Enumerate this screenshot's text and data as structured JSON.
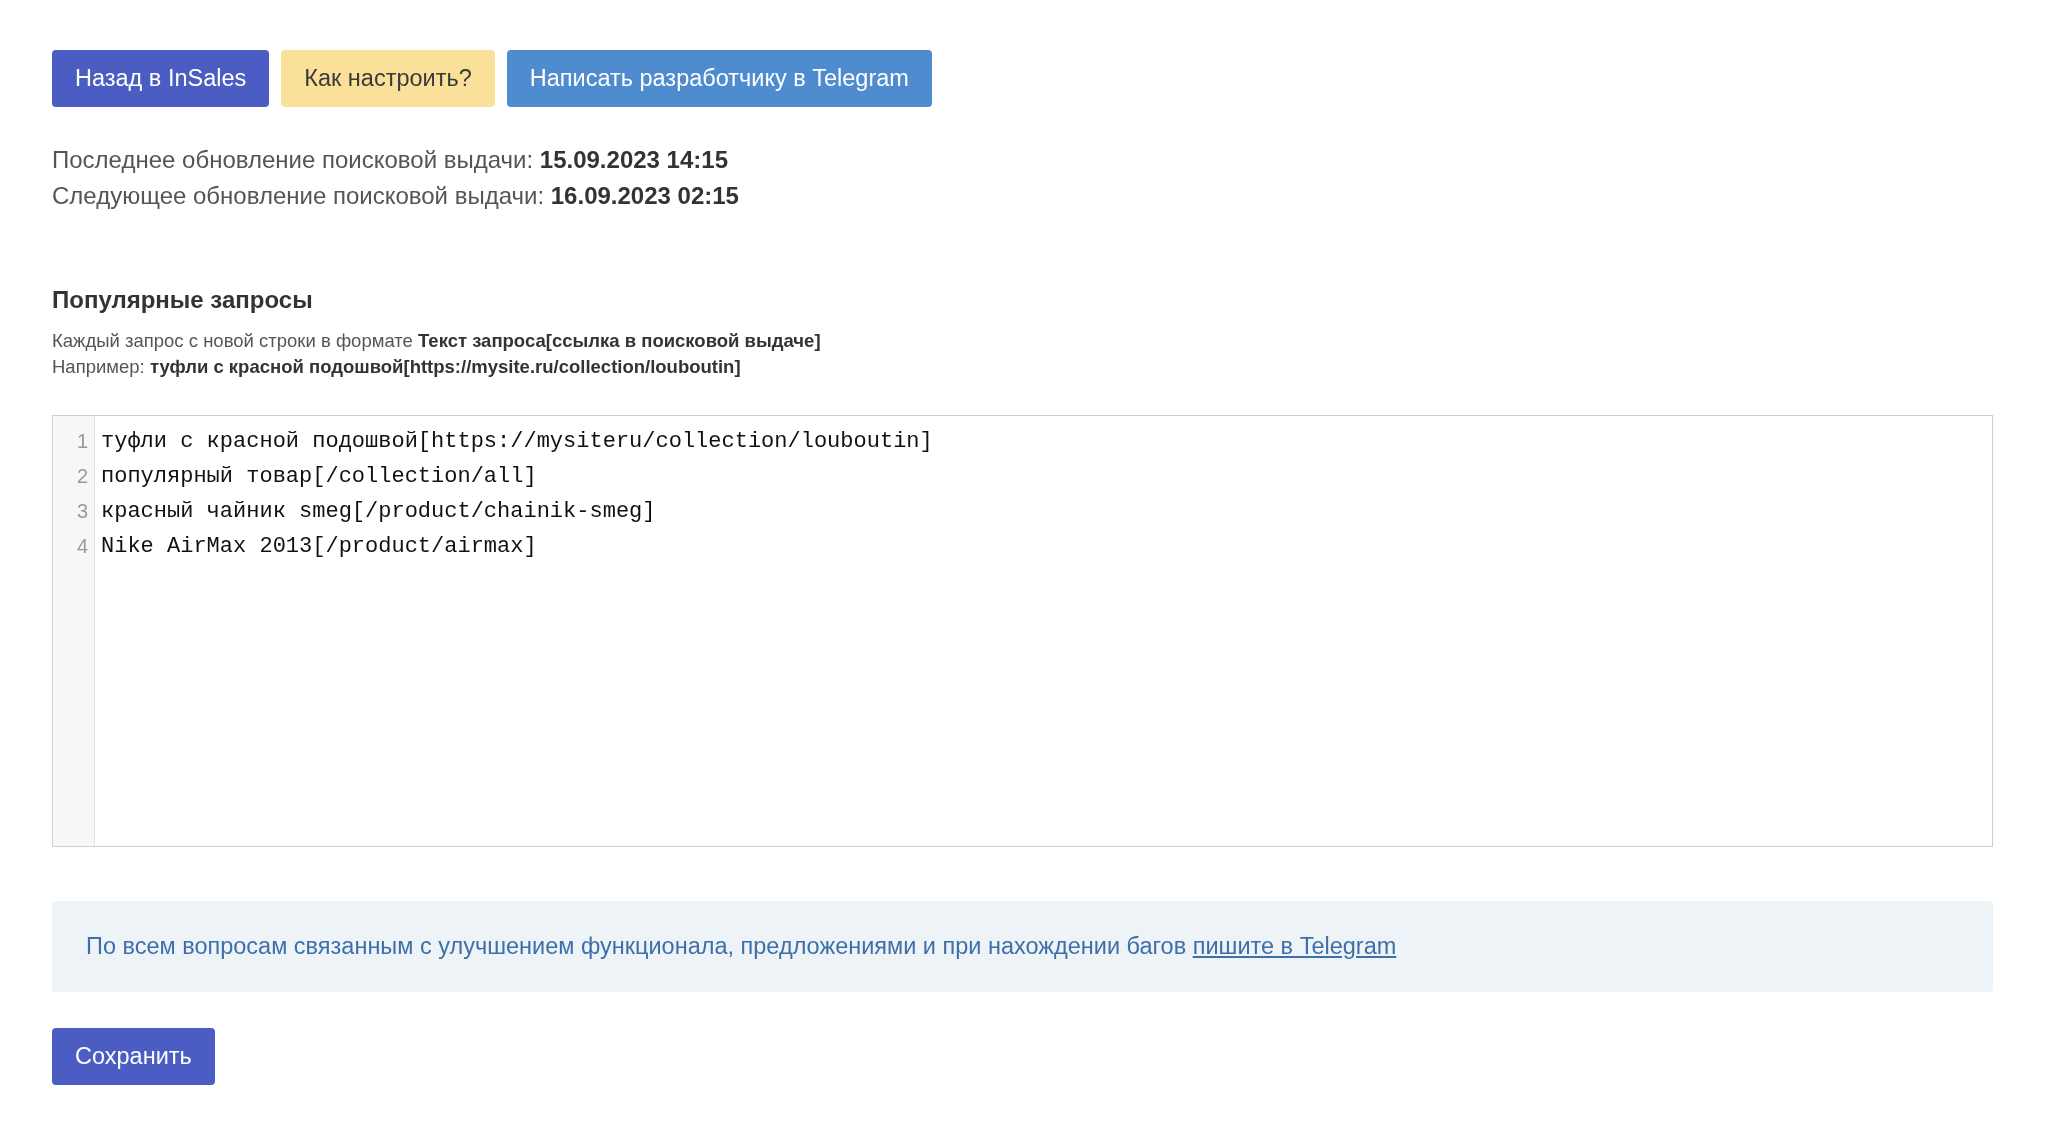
{
  "toolbar": {
    "buttons": [
      {
        "label": "Назад в InSales",
        "kind": "primary"
      },
      {
        "label": "Как настроить?",
        "kind": "warning"
      },
      {
        "label": "Написать разработчику в Telegram",
        "kind": "info"
      }
    ]
  },
  "update_info": [
    "Последнее обновление поисковой выдачи: **15.09.2023 14:15**",
    "Следующее обновление поисковой выдачи: **16.09.2023 02:15**"
  ],
  "popular_queries": {
    "title": "Популярные запросы",
    "hints": [
      "Каждый запрос с новой строки в формате **Текст запроса[ссылка в поисковой выдаче]**",
      "Например: **туфли с красной подошвой[https://mysite.ru/collection/louboutin]**"
    ],
    "editor": {
      "lines": [
        {
          "number": "1",
          "text": "туфли с красной подошвой[https://mysiteru/collection/louboutin]"
        },
        {
          "number": "2",
          "text": "популярный товар[/collection/all]"
        },
        {
          "number": "3",
          "text": "красный чайник smeg[/product/chainik-smeg]"
        },
        {
          "number": "4",
          "text": "Nike AirMax 2013[/product/airmax]"
        }
      ]
    }
  },
  "notice": {
    "text": "По всем вопросам связанным с улучшением функционала, предложениями и при нахождении багов",
    "link": "пишите в Telegram"
  },
  "save_button": "Сохранить"
}
